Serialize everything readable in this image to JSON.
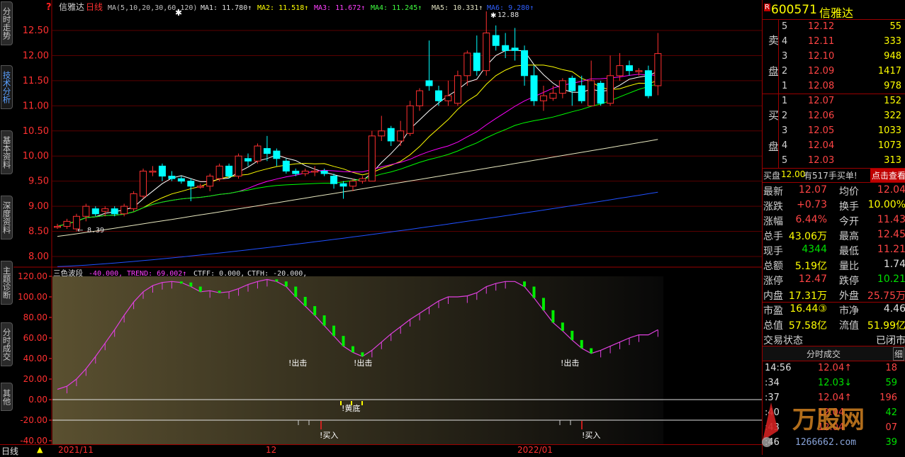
{
  "sidebar": {
    "tabs": [
      {
        "label": "分时走势"
      },
      {
        "label": "技术分析"
      },
      {
        "label": "基本资料"
      },
      {
        "label": "深度资料"
      },
      {
        "label": "主题诊断"
      },
      {
        "label": "分时成交"
      },
      {
        "label": "其他"
      }
    ]
  },
  "header": {
    "stock_name": "信雅达",
    "period": "日线",
    "ma_params": "MA(5,10,20,30,60,120)",
    "ma1": "MA1: 11.780↑",
    "ma2": "MA2: 11.518↑",
    "ma3": "MA3: 11.672↑",
    "ma4": "MA4: 11.245↑",
    "ma5": "MA5: 10.331↑",
    "ma6": "MA6: 9.280↑",
    "close_icon": "?"
  },
  "price_axis": [
    "12.50",
    "12.00",
    "11.50",
    "11.00",
    "10.50",
    "10.00",
    "9.50",
    "9.00",
    "8.50",
    "8.00"
  ],
  "annotations": {
    "high": "12.88",
    "low": "8.39"
  },
  "indicator": {
    "name": "三色波段",
    "v1": "-40.000,",
    "trend": "TREND: 69.002↑",
    "ctff": "CTFF: 0.000,",
    "ctfh": "CTFH: -20.000,",
    "axis": [
      "120.00",
      "100.00",
      "80.00",
      "60.00",
      "40.00",
      "20.00",
      "0.00",
      "-20.00",
      "-40.00"
    ],
    "signals": {
      "out1": "!出击",
      "out2": "!出击",
      "out3": "!出击",
      "bottom": "!黄底",
      "buy1": "!买入",
      "buy2": "!买入"
    }
  },
  "bottom": {
    "period_tab": "日线",
    "dates": [
      "2021/11",
      "12",
      "2022/01"
    ]
  },
  "chart_data": {
    "type": "candlestick",
    "price_range": [
      7.8,
      12.9
    ],
    "candles": [
      [
        8.6,
        8.6,
        8.55,
        8.65
      ],
      [
        8.6,
        8.7,
        8.55,
        8.75
      ],
      [
        8.55,
        8.8,
        8.5,
        8.85
      ],
      [
        8.8,
        9.0,
        8.7,
        9.05
      ],
      [
        8.95,
        8.85,
        8.8,
        9.0
      ],
      [
        8.9,
        8.95,
        8.8,
        9.0
      ],
      [
        8.95,
        8.85,
        8.8,
        9.0
      ],
      [
        8.85,
        9.0,
        8.8,
        9.05
      ],
      [
        8.95,
        9.25,
        8.9,
        9.3
      ],
      [
        9.2,
        9.7,
        9.15,
        9.75
      ],
      [
        9.7,
        9.7,
        9.6,
        9.8
      ],
      [
        9.8,
        9.6,
        9.5,
        9.85
      ],
      [
        9.6,
        9.55,
        9.5,
        9.7
      ],
      [
        9.55,
        9.5,
        9.45,
        9.6
      ],
      [
        9.5,
        9.4,
        9.1,
        9.55
      ],
      [
        9.4,
        9.4,
        9.35,
        9.45
      ],
      [
        9.4,
        9.6,
        9.3,
        9.65
      ],
      [
        9.55,
        9.8,
        9.5,
        9.85
      ],
      [
        9.8,
        9.6,
        9.55,
        9.85
      ],
      [
        9.6,
        10.0,
        9.55,
        10.05
      ],
      [
        9.95,
        9.9,
        9.8,
        10.05
      ],
      [
        9.9,
        10.2,
        9.85,
        10.25
      ],
      [
        10.15,
        10.05,
        9.9,
        10.4
      ],
      [
        10.1,
        9.95,
        9.8,
        10.15
      ],
      [
        9.9,
        9.7,
        9.65,
        9.95
      ],
      [
        9.7,
        9.65,
        9.6,
        9.75
      ],
      [
        9.65,
        9.7,
        9.6,
        9.75
      ],
      [
        9.7,
        9.7,
        9.6,
        9.8
      ],
      [
        9.7,
        9.65,
        9.6,
        9.75
      ],
      [
        9.6,
        9.45,
        9.35,
        9.65
      ],
      [
        9.45,
        9.4,
        9.15,
        9.5
      ],
      [
        9.4,
        9.5,
        9.3,
        9.55
      ],
      [
        9.5,
        9.55,
        9.45,
        9.6
      ],
      [
        9.5,
        10.4,
        9.5,
        10.5
      ],
      [
        10.4,
        10.5,
        10.3,
        10.8
      ],
      [
        10.55,
        10.3,
        10.2,
        10.6
      ],
      [
        10.3,
        10.5,
        10.2,
        10.7
      ],
      [
        10.45,
        11.0,
        10.4,
        11.1
      ],
      [
        11.0,
        11.3,
        10.9,
        11.35
      ],
      [
        11.5,
        11.4,
        11.3,
        12.3
      ],
      [
        11.3,
        11.1,
        11.0,
        11.4
      ],
      [
        11.1,
        11.2,
        11.0,
        11.5
      ],
      [
        11.05,
        11.6,
        11.0,
        11.7
      ],
      [
        11.6,
        12.05,
        11.4,
        12.1
      ],
      [
        12.05,
        11.7,
        11.6,
        12.4
      ],
      [
        11.7,
        12.45,
        11.6,
        12.88
      ],
      [
        12.4,
        12.2,
        12.1,
        12.6
      ],
      [
        12.2,
        12.1,
        11.95,
        12.45
      ],
      [
        12.15,
        12.1,
        11.9,
        12.55
      ],
      [
        12.1,
        11.6,
        11.4,
        12.2
      ],
      [
        11.6,
        11.1,
        11.0,
        11.8
      ],
      [
        11.1,
        11.2,
        10.9,
        11.4
      ],
      [
        11.15,
        11.25,
        11.1,
        11.4
      ],
      [
        11.25,
        11.5,
        11.15,
        11.55
      ],
      [
        11.55,
        11.3,
        11.0,
        11.6
      ],
      [
        11.4,
        11.1,
        11.05,
        11.6
      ],
      [
        11.0,
        11.5,
        11.0,
        11.9
      ],
      [
        11.45,
        11.05,
        11.0,
        11.5
      ],
      [
        11.05,
        11.6,
        11.0,
        12.0
      ],
      [
        11.6,
        11.8,
        11.5,
        12.05
      ],
      [
        11.8,
        11.7,
        11.6,
        11.9
      ],
      [
        11.7,
        11.7,
        11.6,
        11.75
      ],
      [
        11.7,
        11.2,
        11.15,
        11.8
      ],
      [
        11.4,
        12.04,
        11.21,
        12.45
      ]
    ],
    "ma_lines": [
      {
        "name": "MA1",
        "color": "#ffffff"
      },
      {
        "name": "MA2",
        "color": "#ffff00"
      },
      {
        "name": "MA3",
        "color": "#ff00ff"
      },
      {
        "name": "MA4",
        "color": "#00ff00"
      },
      {
        "name": "MA5",
        "color": "#e8e8c0"
      },
      {
        "name": "MA6",
        "color": "#2050ff"
      }
    ],
    "indicator_range": [
      -40,
      125
    ],
    "indicator_values": [
      10,
      13,
      20,
      30,
      42,
      55,
      68,
      82,
      95,
      105,
      111,
      114,
      115,
      114,
      110,
      105,
      106,
      104,
      105,
      108,
      112,
      115,
      117,
      115,
      110,
      100,
      91,
      82,
      72,
      62,
      52,
      46,
      42,
      48,
      56,
      64,
      71,
      78,
      84,
      90,
      96,
      100,
      100,
      101,
      104,
      110,
      113,
      115,
      115,
      110,
      99,
      87,
      75,
      67,
      58,
      50,
      45,
      48,
      52,
      56,
      60,
      63,
      63,
      68
    ]
  },
  "order_book": {
    "code": "600571",
    "name": "信雅达",
    "sell_label": "卖",
    "buy_label": "买",
    "pan_label": "盘",
    "sell": [
      {
        "lvl": "5",
        "price": "12.12",
        "vol": "55"
      },
      {
        "lvl": "4",
        "price": "12.11",
        "vol": "333"
      },
      {
        "lvl": "3",
        "price": "12.10",
        "vol": "948"
      },
      {
        "lvl": "2",
        "price": "12.09",
        "vol": "1417"
      },
      {
        "lvl": "1",
        "price": "12.08",
        "vol": "978"
      }
    ],
    "buy": [
      {
        "lvl": "1",
        "price": "12.07",
        "vol": "152"
      },
      {
        "lvl": "2",
        "price": "12.06",
        "vol": "322"
      },
      {
        "lvl": "3",
        "price": "12.05",
        "vol": "1033"
      },
      {
        "lvl": "4",
        "price": "12.04",
        "vol": "1073"
      },
      {
        "lvl": "5",
        "price": "12.03",
        "vol": "313"
      }
    ],
    "notice_prefix": "买盘",
    "notice_price": "12.00",
    "notice_suffix": "有517手买单!",
    "notice_button": "点击查看"
  },
  "quote": [
    [
      "最新",
      "12.07",
      "均价",
      "12.04"
    ],
    [
      "涨跌",
      "+0.73",
      "换手",
      "10.00%"
    ],
    [
      "涨幅",
      "6.44%",
      "今开",
      "11.43"
    ],
    [
      "总手",
      "43.06万",
      "最高",
      "12.45"
    ],
    [
      "现手",
      "4344",
      "最低",
      "11.21"
    ],
    [
      "总额",
      "5.19亿",
      "量比",
      "1.74"
    ],
    [
      "涨停",
      "12.47",
      "跌停",
      "10.21"
    ],
    [
      "内盘",
      "17.31万",
      "外盘",
      "25.75万"
    ],
    [
      "市盈",
      "16.44③",
      "市净",
      "4.46"
    ],
    [
      "总值",
      "57.58亿",
      "流值",
      "51.99亿"
    ],
    [
      "交易状态",
      "",
      "",
      "已闭市"
    ]
  ],
  "ticks": {
    "title": "分时成交",
    "detail": "细",
    "rows": [
      {
        "time": "14:56",
        "price": "12.04↑",
        "vol": "18"
      },
      {
        "time": ":34",
        "price": "12.03↓",
        "vol": "59"
      },
      {
        "time": ":37",
        "price": "12.04↑",
        "vol": "196"
      },
      {
        "time": ":40",
        "price": "12.04",
        "vol": "42"
      },
      {
        "time": ":43",
        "price": "12.04",
        "vol": "07"
      },
      {
        "time": ":46",
        "price": "",
        "vol": "39"
      }
    ]
  },
  "watermark": {
    "brand": "万股网",
    "site": "1266662.com"
  }
}
